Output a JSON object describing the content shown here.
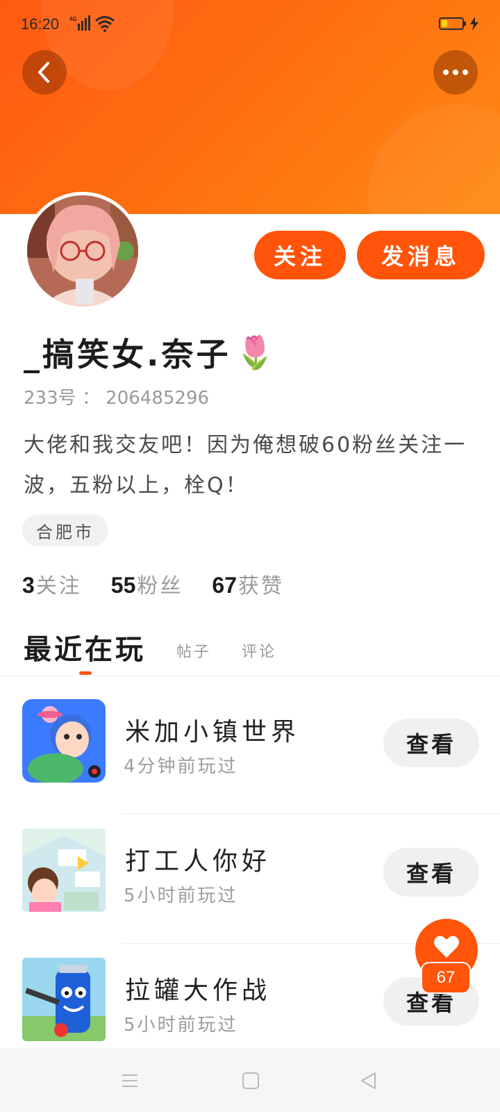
{
  "status_bar": {
    "time": "16:20",
    "network": "4G",
    "icons": [
      "signal-icon",
      "wifi-icon",
      "battery-icon",
      "charging-icon"
    ]
  },
  "header": {
    "back_icon": "chevron-left-icon",
    "more_icon": "more-horizontal-icon"
  },
  "profile": {
    "follow_label": "关注",
    "message_label": "发消息",
    "username": "_搞笑女.奈子",
    "username_emoji": "🌷",
    "id_text": "233号 ： 206485296",
    "bio": "大佬和我交友吧！因为俺想破60粉丝关注一波，五粉以上，栓Q！",
    "location": "合肥市",
    "stats": [
      {
        "num": "3",
        "label": "关注"
      },
      {
        "num": "55",
        "label": "粉丝"
      },
      {
        "num": "67",
        "label": "获赞"
      }
    ]
  },
  "tabs": {
    "active": "最近在玩",
    "posts": "帖子",
    "comments": "评论"
  },
  "games": [
    {
      "title": "米加小镇世界",
      "played": "4分钟前玩过",
      "button": "查看"
    },
    {
      "title": "打工人你好",
      "played": "5小时前玩过",
      "button": "查看"
    },
    {
      "title": "拉罐大作战",
      "played": "5小时前玩过",
      "button": "查看"
    }
  ],
  "like_fab": {
    "count": "67",
    "icon": "heart-icon"
  },
  "nav": {
    "icons": [
      "menu-icon",
      "home-square-icon",
      "back-triangle-icon"
    ]
  },
  "colors": {
    "accent": "#ff540a",
    "banner_start": "#ff5a12",
    "banner_end": "#ff8a14"
  }
}
